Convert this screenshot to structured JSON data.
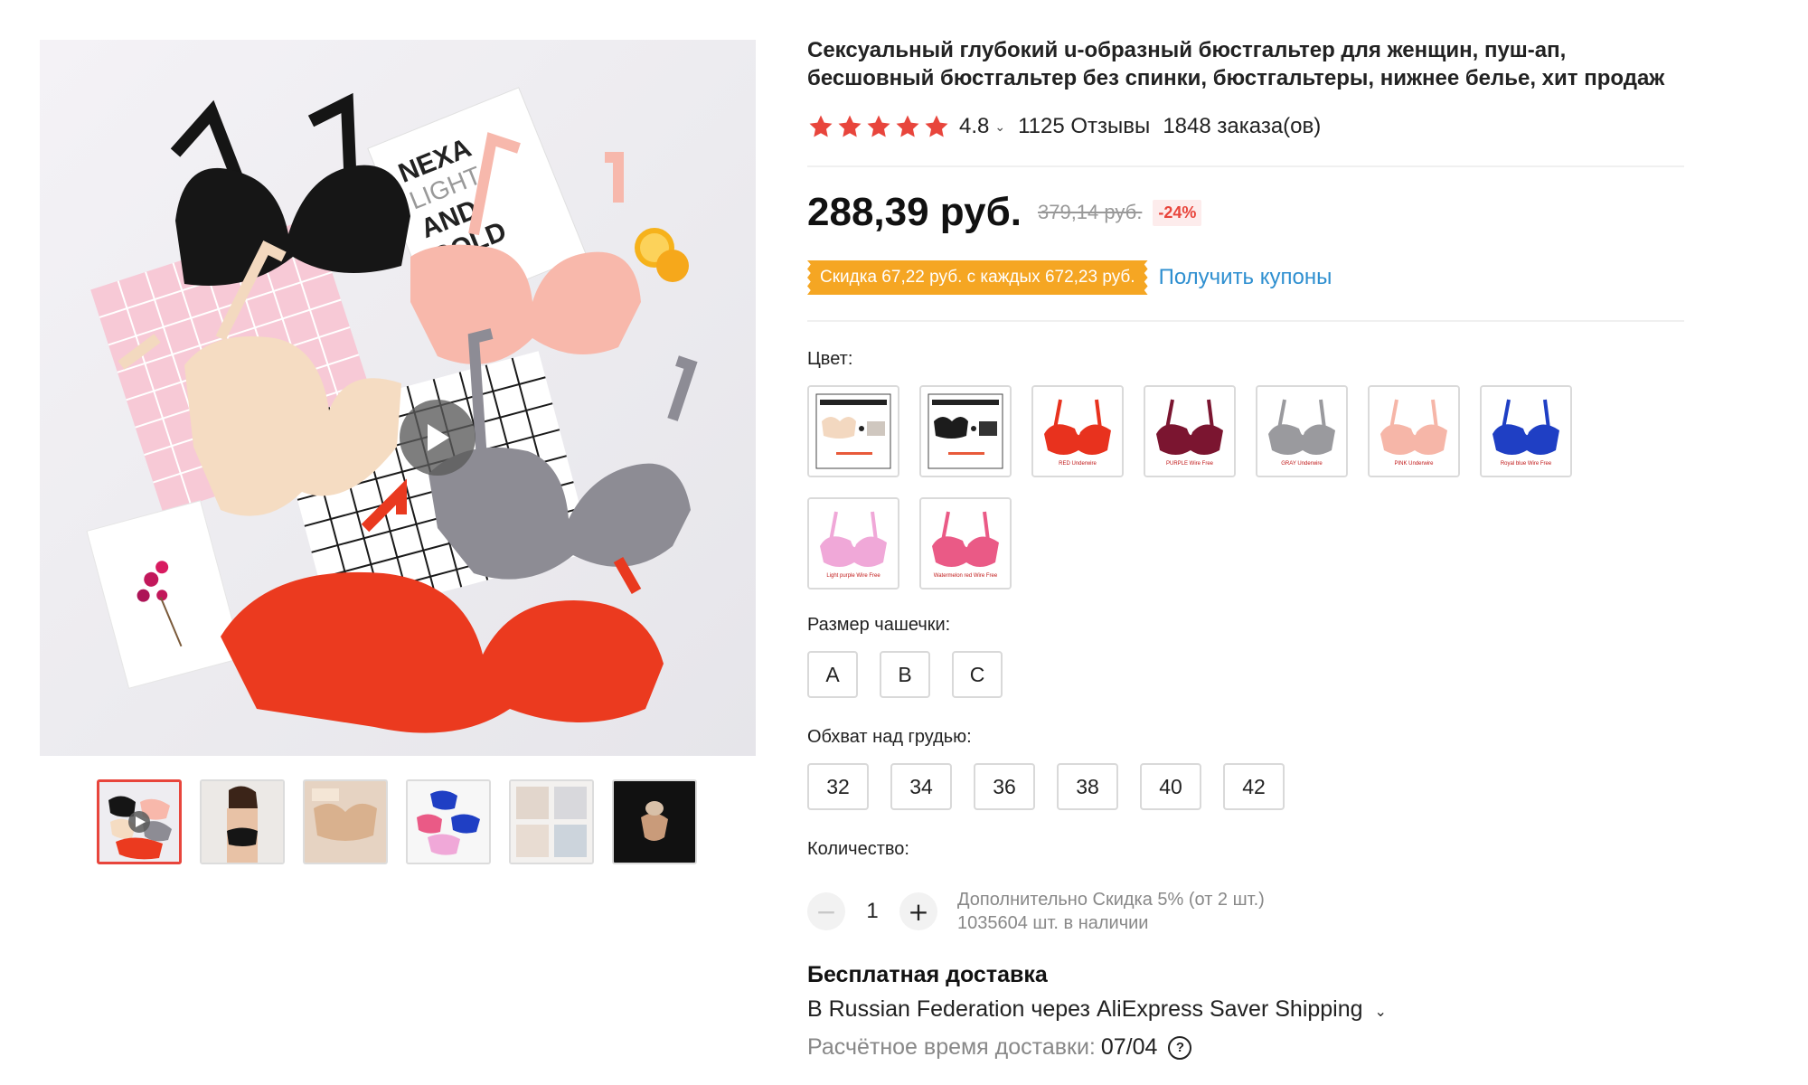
{
  "product": {
    "title": "Сексуальный глубокий u-образный бюстгальтер для женщин, пуш-ап, бесшовный бюстгальтер без спинки, бюстгальтеры, нижнее белье, хит продаж",
    "rating": "4.8",
    "rating_stars": 5,
    "reviews": "1125 Отзывы",
    "orders": "1848 заказа(ов)"
  },
  "gallery": {
    "main_image_text": "NEXA LIGHT AND BOLD",
    "thumbnails": [
      "thumb-1",
      "thumb-2",
      "thumb-3",
      "thumb-4",
      "thumb-5",
      "thumb-6"
    ],
    "active_index": 0
  },
  "price": {
    "current": "288,39 руб.",
    "old": "379,14 руб.",
    "discount": "-24%"
  },
  "coupon": {
    "tag": "Скидка 67,22 руб. с каждых 672,23 руб.",
    "link": "Получить купоны"
  },
  "color": {
    "label": "Цвет:",
    "options": [
      {
        "caption": "",
        "color": "#f3d8c0"
      },
      {
        "caption": "",
        "color": "#1c1c1c"
      },
      {
        "caption": "RED Underwire",
        "color": "#e8321e"
      },
      {
        "caption": "PURPLE Wire Free",
        "color": "#7b1530"
      },
      {
        "caption": "GRAY Underwire",
        "color": "#9a9a9e"
      },
      {
        "caption": "PINK Underwire",
        "color": "#f6b6a8"
      },
      {
        "caption": "Royal blue Wire Free",
        "color": "#1f3fc4"
      },
      {
        "caption": "Light purple Wire Free",
        "color": "#f0a8d8"
      },
      {
        "caption": "Watermelon red Wire Free",
        "color": "#ea5a86"
      }
    ]
  },
  "cup_size": {
    "label": "Размер чашечки:",
    "options": [
      "A",
      "B",
      "C"
    ]
  },
  "band_size": {
    "label": "Обхват над грудью:",
    "options": [
      "32",
      "34",
      "36",
      "38",
      "40",
      "42"
    ]
  },
  "quantity": {
    "label": "Количество:",
    "value": "1",
    "extra_discount": "Дополнительно Скидка 5% (от 2 шт.)",
    "stock": "1035604 шт. в наличии"
  },
  "shipping": {
    "title": "Бесплатная доставка",
    "line": "В Russian Federation через AliExpress Saver Shipping",
    "delivery_label": "Расчётное время доставки:",
    "delivery_date": "07/04"
  },
  "colors": {
    "accent": "#e8453c",
    "star": "#e8453c",
    "coupon": "#f5a623",
    "link": "#2e8fd0"
  }
}
